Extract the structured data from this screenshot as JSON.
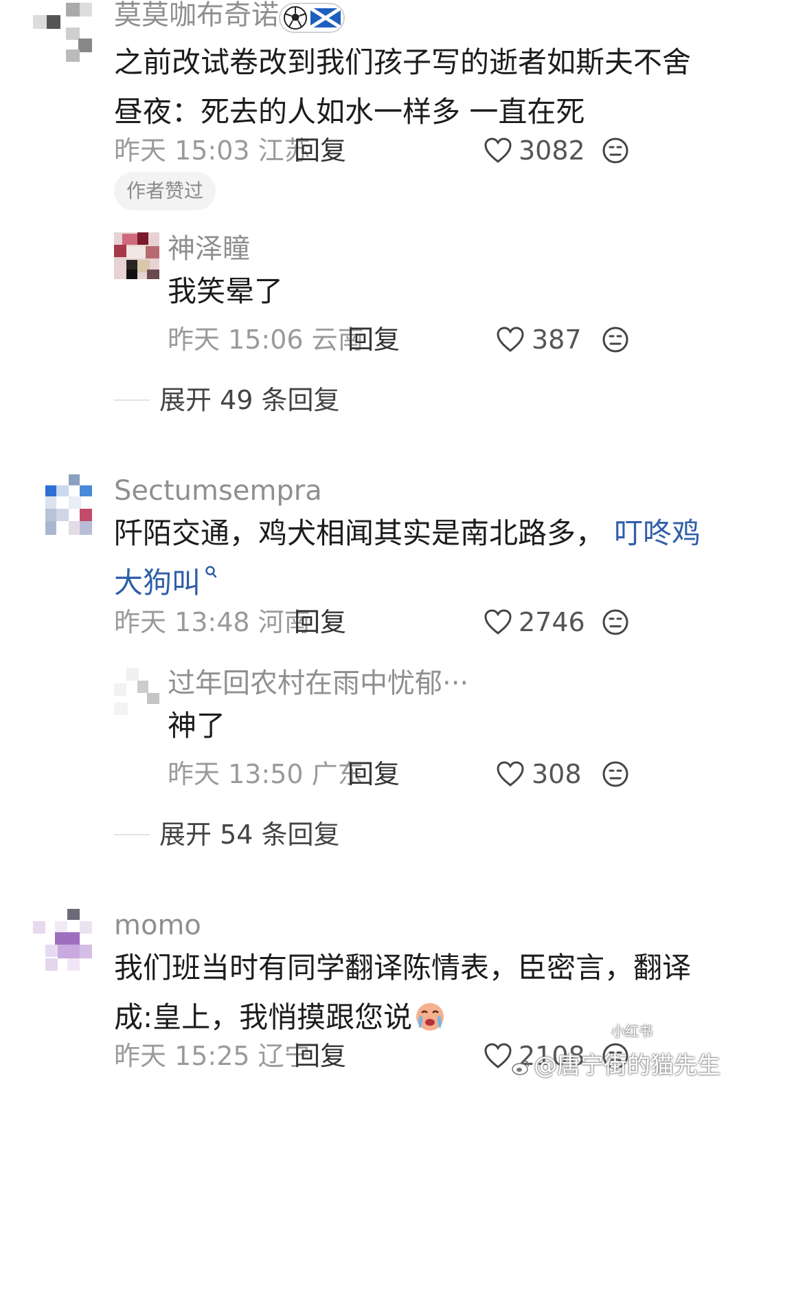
{
  "comments": [
    {
      "username": "莫莫咖布奇诺",
      "text_line1": "之前改试卷改到我们孩子写的逝者如斯夫不舍",
      "text_line2": "昼夜：死去的人如水一样多 一直在死",
      "meta": "昨天 15:03 江苏",
      "reply_label": "回复",
      "likes": "3082",
      "badge": "作者赞过",
      "sub_reply": {
        "username": "神泽瞳",
        "text": "我笑晕了",
        "meta": "昨天 15:06 云南",
        "reply_label": "回复",
        "likes": "387"
      },
      "expand": "展开 49 条回复"
    },
    {
      "username": "Sectumsempra",
      "text_line1_plain": "阡陌交通，鸡犬相闻其实是南北路多，",
      "text_line1_link": "叮咚鸡",
      "text_line2_link": "大狗叫",
      "meta": "昨天 13:48 河南",
      "reply_label": "回复",
      "likes": "2746",
      "sub_reply": {
        "username": "过年回农村在雨中忧郁···",
        "text": "神了",
        "meta": "昨天 13:50 广东",
        "reply_label": "回复",
        "likes": "308"
      },
      "expand": "展开 54 条回复"
    },
    {
      "username": "momo",
      "text_line1": "我们班当时有同学翻译陈情表，臣密言，翻译",
      "text_line2": "成:皇上，我悄摸跟您说",
      "meta": "昨天 15:25 辽宁",
      "reply_label": "回复",
      "likes": "2108"
    }
  ],
  "icons": {
    "like": "heart-outline-icon",
    "dislike": "neutral-face-icon",
    "badge_emoji": "soccer-ball-icon",
    "flag": "scotland-flag-icon",
    "search": "search-icon",
    "crying": "crying-emoji-icon"
  },
  "colors": {
    "link": "#2e5fa8",
    "username": "#8f8f8f",
    "meta": "#9a9a9a"
  },
  "watermark": {
    "text": "@唐宁街的猫先生",
    "small": "小红书"
  }
}
